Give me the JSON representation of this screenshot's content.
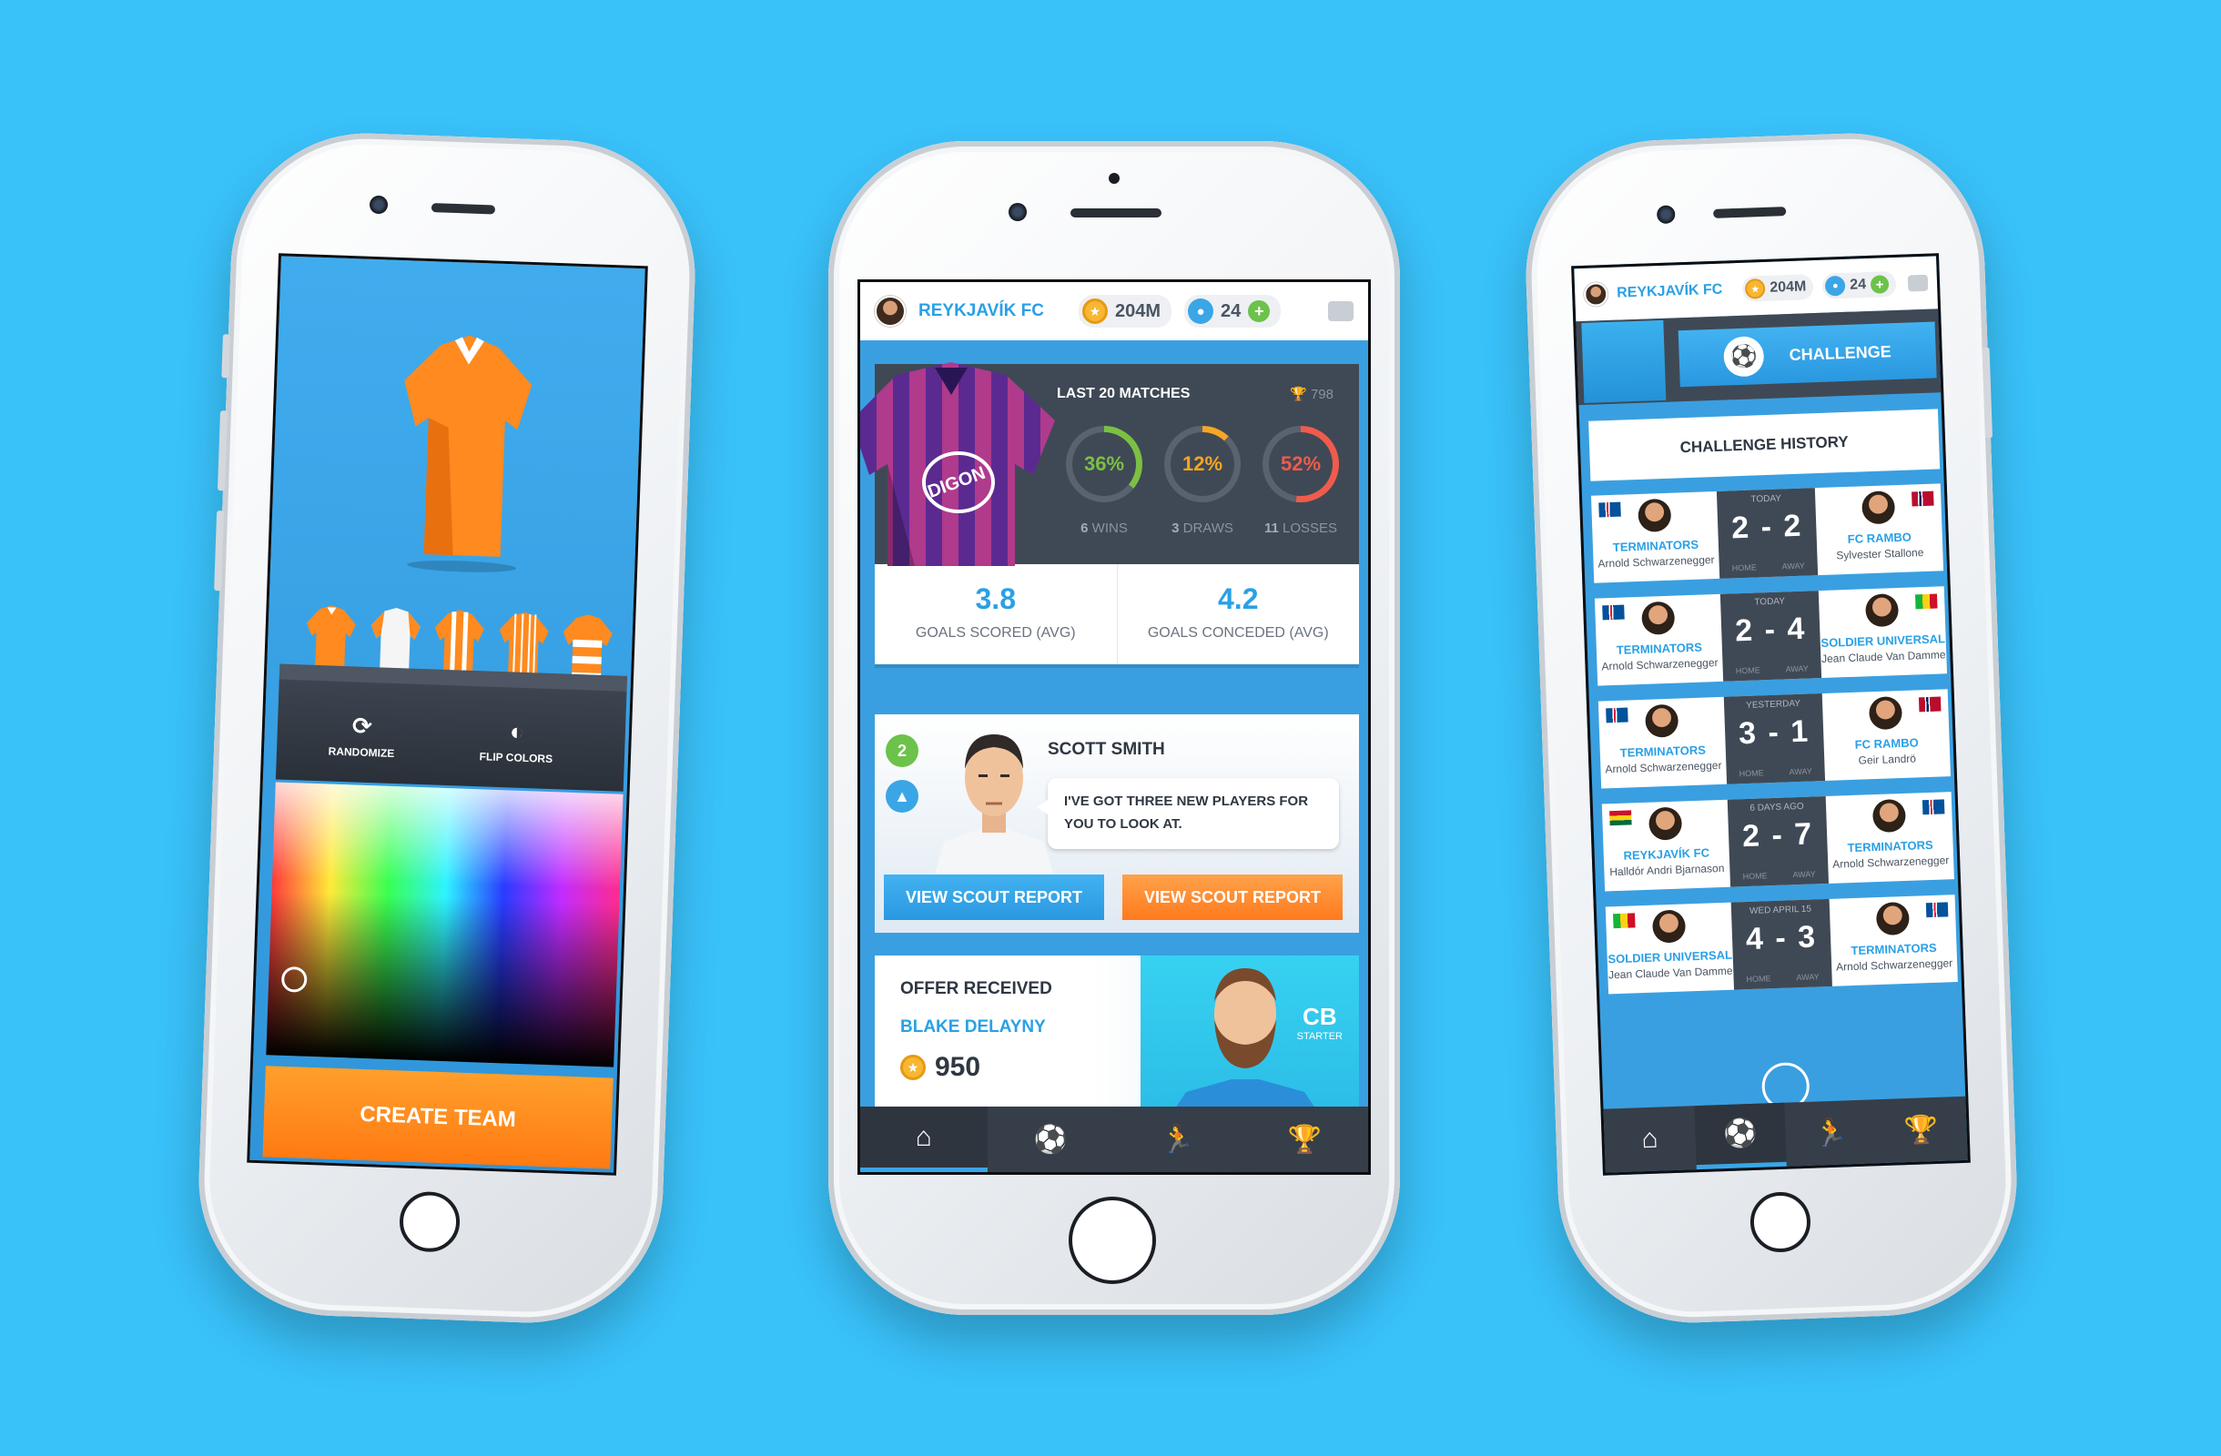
{
  "left_phone": {
    "tools": {
      "randomize": "RANDOMIZE",
      "flip_colors": "FLIP COLORS"
    },
    "create_button": "CREATE TEAM"
  },
  "header": {
    "team": "REYKJAVÍK FC",
    "coins": "204M",
    "players": "24"
  },
  "stats": {
    "title": "LAST 20 MATCHES",
    "trophies": "798",
    "wins": {
      "pct": "36%",
      "label_num": "6",
      "label": "WINS"
    },
    "draws": {
      "pct": "12%",
      "label_num": "3",
      "label": "DRAWS"
    },
    "losses": {
      "pct": "52%",
      "label_num": "11",
      "label": "LOSSES"
    },
    "goals_scored": {
      "value": "3.8",
      "label": "GOALS SCORED (AVG)"
    },
    "goals_conceded": {
      "value": "4.2",
      "label": "GOALS CONCEDED (AVG)"
    }
  },
  "scout": {
    "level": "2",
    "name": "SCOTT SMITH",
    "message": "I'VE GOT THREE NEW PLAYERS FOR YOU TO LOOK AT.",
    "button_left": "VIEW SCOUT REPORT",
    "button_right": "VIEW SCOUT REPORT"
  },
  "offer": {
    "title": "OFFER RECEIVED",
    "player": "BLAKE DELAYNY",
    "price": "950",
    "position": "CB",
    "role": "STARTER"
  },
  "right_phone": {
    "team": "REYKJAVÍK FC",
    "coins": "204M",
    "players": "24",
    "challenge": "CHALLENGE",
    "history_title": "CHALLENGE HISTORY",
    "home_label": "HOME",
    "away_label": "AWAY",
    "matches": [
      {
        "when": "TODAY",
        "score": "2 - 2",
        "home_club": "TERMINATORS",
        "home_manager": "Arnold Schwarzenegger",
        "away_club": "FC RAMBO",
        "away_manager": "Sylvester Stallone"
      },
      {
        "when": "TODAY",
        "score": "2 - 4",
        "home_club": "TERMINATORS",
        "home_manager": "Arnold Schwarzenegger",
        "away_club": "SOLDIER UNIVERSAL",
        "away_manager": "Jean Claude Van Damme"
      },
      {
        "when": "YESTERDAY",
        "score": "3 - 1",
        "home_club": "TERMINATORS",
        "home_manager": "Arnold Schwarzenegger",
        "away_club": "FC RAMBO",
        "away_manager": "Geir Landrö"
      },
      {
        "when": "6 DAYS AGO",
        "score": "2 - 7",
        "home_club": "REYKJAVÍK FC",
        "home_manager": "Halldór Andri Bjarnason",
        "away_club": "TERMINATORS",
        "away_manager": "Arnold Schwarzenegger"
      },
      {
        "when": "WED APRIL 15",
        "score": "4 - 3",
        "home_club": "SOLDIER UNIVERSAL",
        "home_manager": "Jean Claude Van Damme",
        "away_club": "TERMINATORS",
        "away_manager": "Arnold Schwarzenegger"
      }
    ]
  },
  "jersey_brand": "DIGON",
  "colors": {
    "background": "#39c1f9",
    "accent_blue": "#2aa0e6",
    "accent_orange": "#ff7a12",
    "win_green": "#7bc043",
    "draw_orange": "#f5a623",
    "loss_red": "#ef5b4c",
    "panel_dark": "#3f4955"
  }
}
